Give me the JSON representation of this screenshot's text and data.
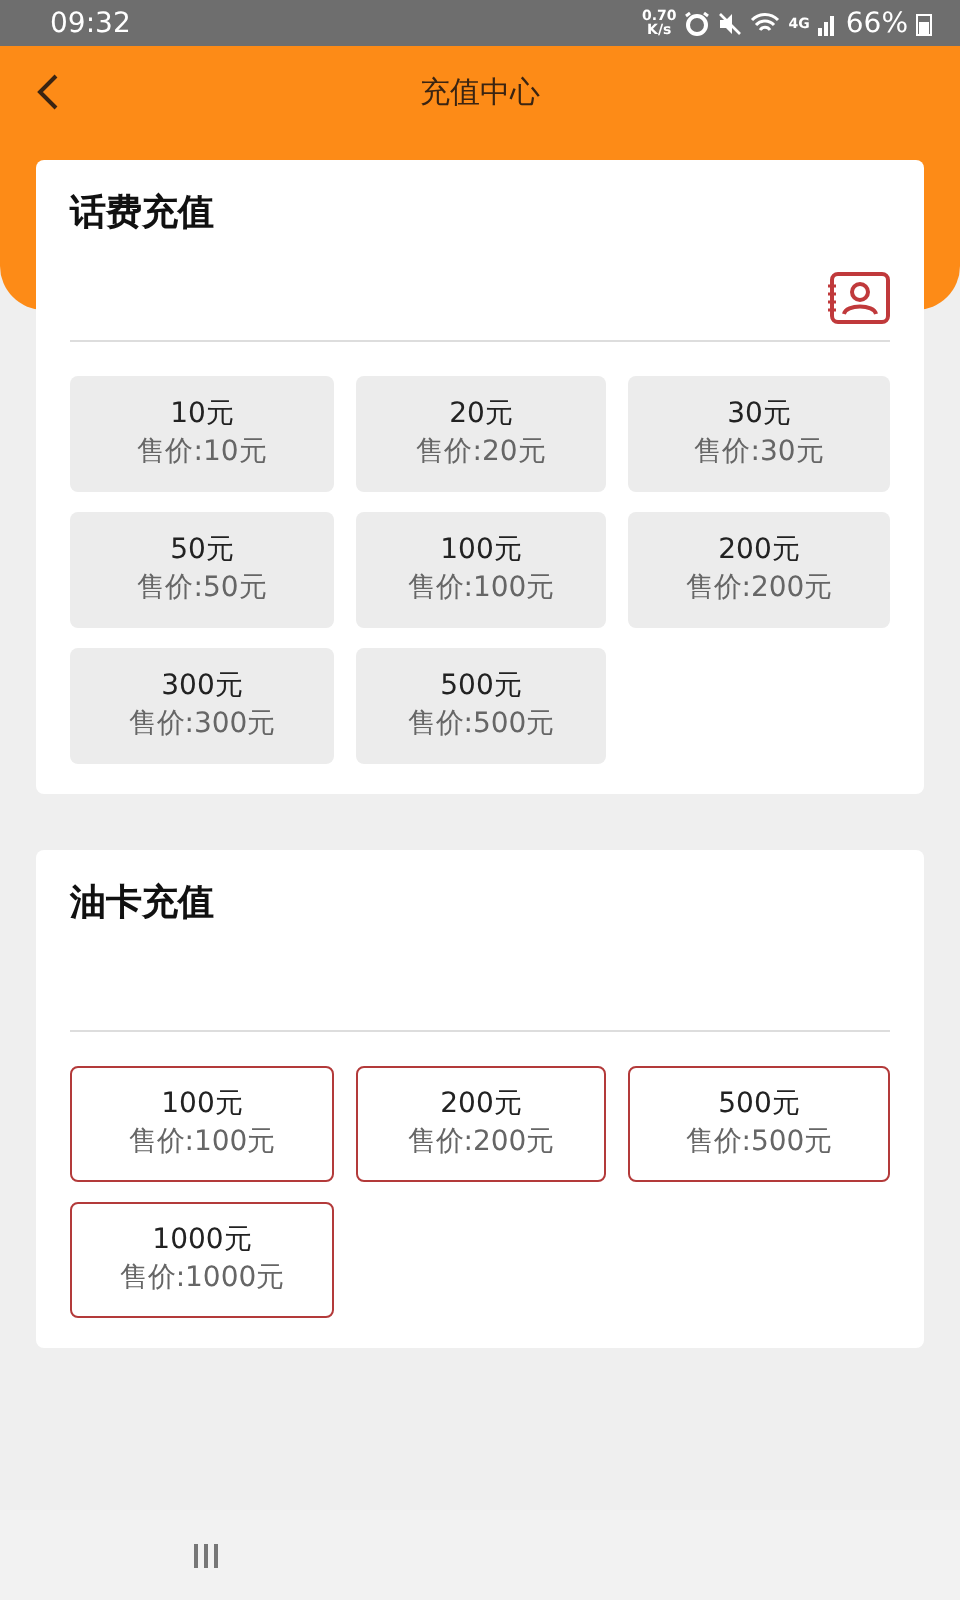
{
  "status_bar": {
    "time": "09:32",
    "speed": "0.70",
    "speed_unit": "K/s",
    "network": "4G",
    "battery": "66%"
  },
  "header": {
    "title": "充值中心"
  },
  "sections": [
    {
      "title": "话费充值",
      "kind": "filled",
      "contacts": true,
      "options": [
        {
          "amount": "10元",
          "price": "售价:10元"
        },
        {
          "amount": "20元",
          "price": "售价:20元"
        },
        {
          "amount": "30元",
          "price": "售价:30元"
        },
        {
          "amount": "50元",
          "price": "售价:50元"
        },
        {
          "amount": "100元",
          "price": "售价:100元"
        },
        {
          "amount": "200元",
          "price": "售价:200元"
        },
        {
          "amount": "300元",
          "price": "售价:300元"
        },
        {
          "amount": "500元",
          "price": "售价:500元"
        }
      ]
    },
    {
      "title": "油卡充值",
      "kind": "outlined",
      "contacts": false,
      "options": [
        {
          "amount": "100元",
          "price": "售价:100元"
        },
        {
          "amount": "200元",
          "price": "售价:200元"
        },
        {
          "amount": "500元",
          "price": "售价:500元"
        },
        {
          "amount": "1000元",
          "price": "售价:1000元"
        }
      ]
    }
  ]
}
